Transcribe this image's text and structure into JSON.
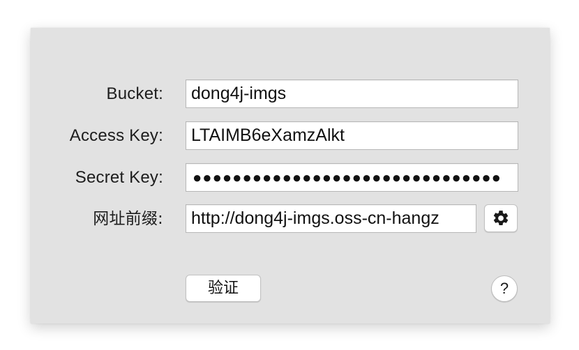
{
  "form": {
    "bucket_label": "Bucket:",
    "bucket_value": "dong4j-imgs",
    "access_key_label": "Access Key:",
    "access_key_value": "LTAIMB6eXamzAlkt",
    "secret_key_label": "Secret Key:",
    "secret_key_value": "●●●●●●●●●●●●●●●●●●●●●●●●●●●●●●●",
    "url_prefix_label": "网址前缀:",
    "url_prefix_value": "http://dong4j-imgs.oss-cn-hangz"
  },
  "actions": {
    "verify_label": "验证",
    "help_label": "?",
    "gear_icon": "gear-icon"
  }
}
